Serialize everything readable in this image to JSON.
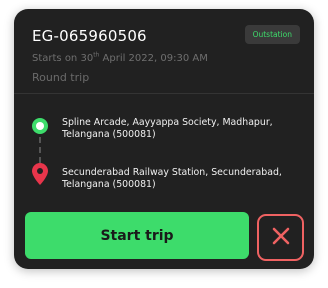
{
  "trip": {
    "id": "EG-065960506",
    "badge": "Outstation",
    "starts_prefix": "Starts on 30",
    "starts_ordinal": "th",
    "starts_suffix": " April 2022, 09:30 AM",
    "type": "Round trip"
  },
  "route": {
    "pickup_address": "Spline Arcade, Aayyappa Society, Madhapur, Telangana (500081)",
    "drop_address": "Secunderabad Railway Station, Secunderabad, Telangana (500081)"
  },
  "actions": {
    "start_label": "Start trip",
    "cancel_icon": "close-icon"
  },
  "colors": {
    "card_bg": "#212121",
    "accent_green": "#3ddc6b",
    "cancel_red": "#ef6262",
    "drop_pin": "#e8354b"
  }
}
